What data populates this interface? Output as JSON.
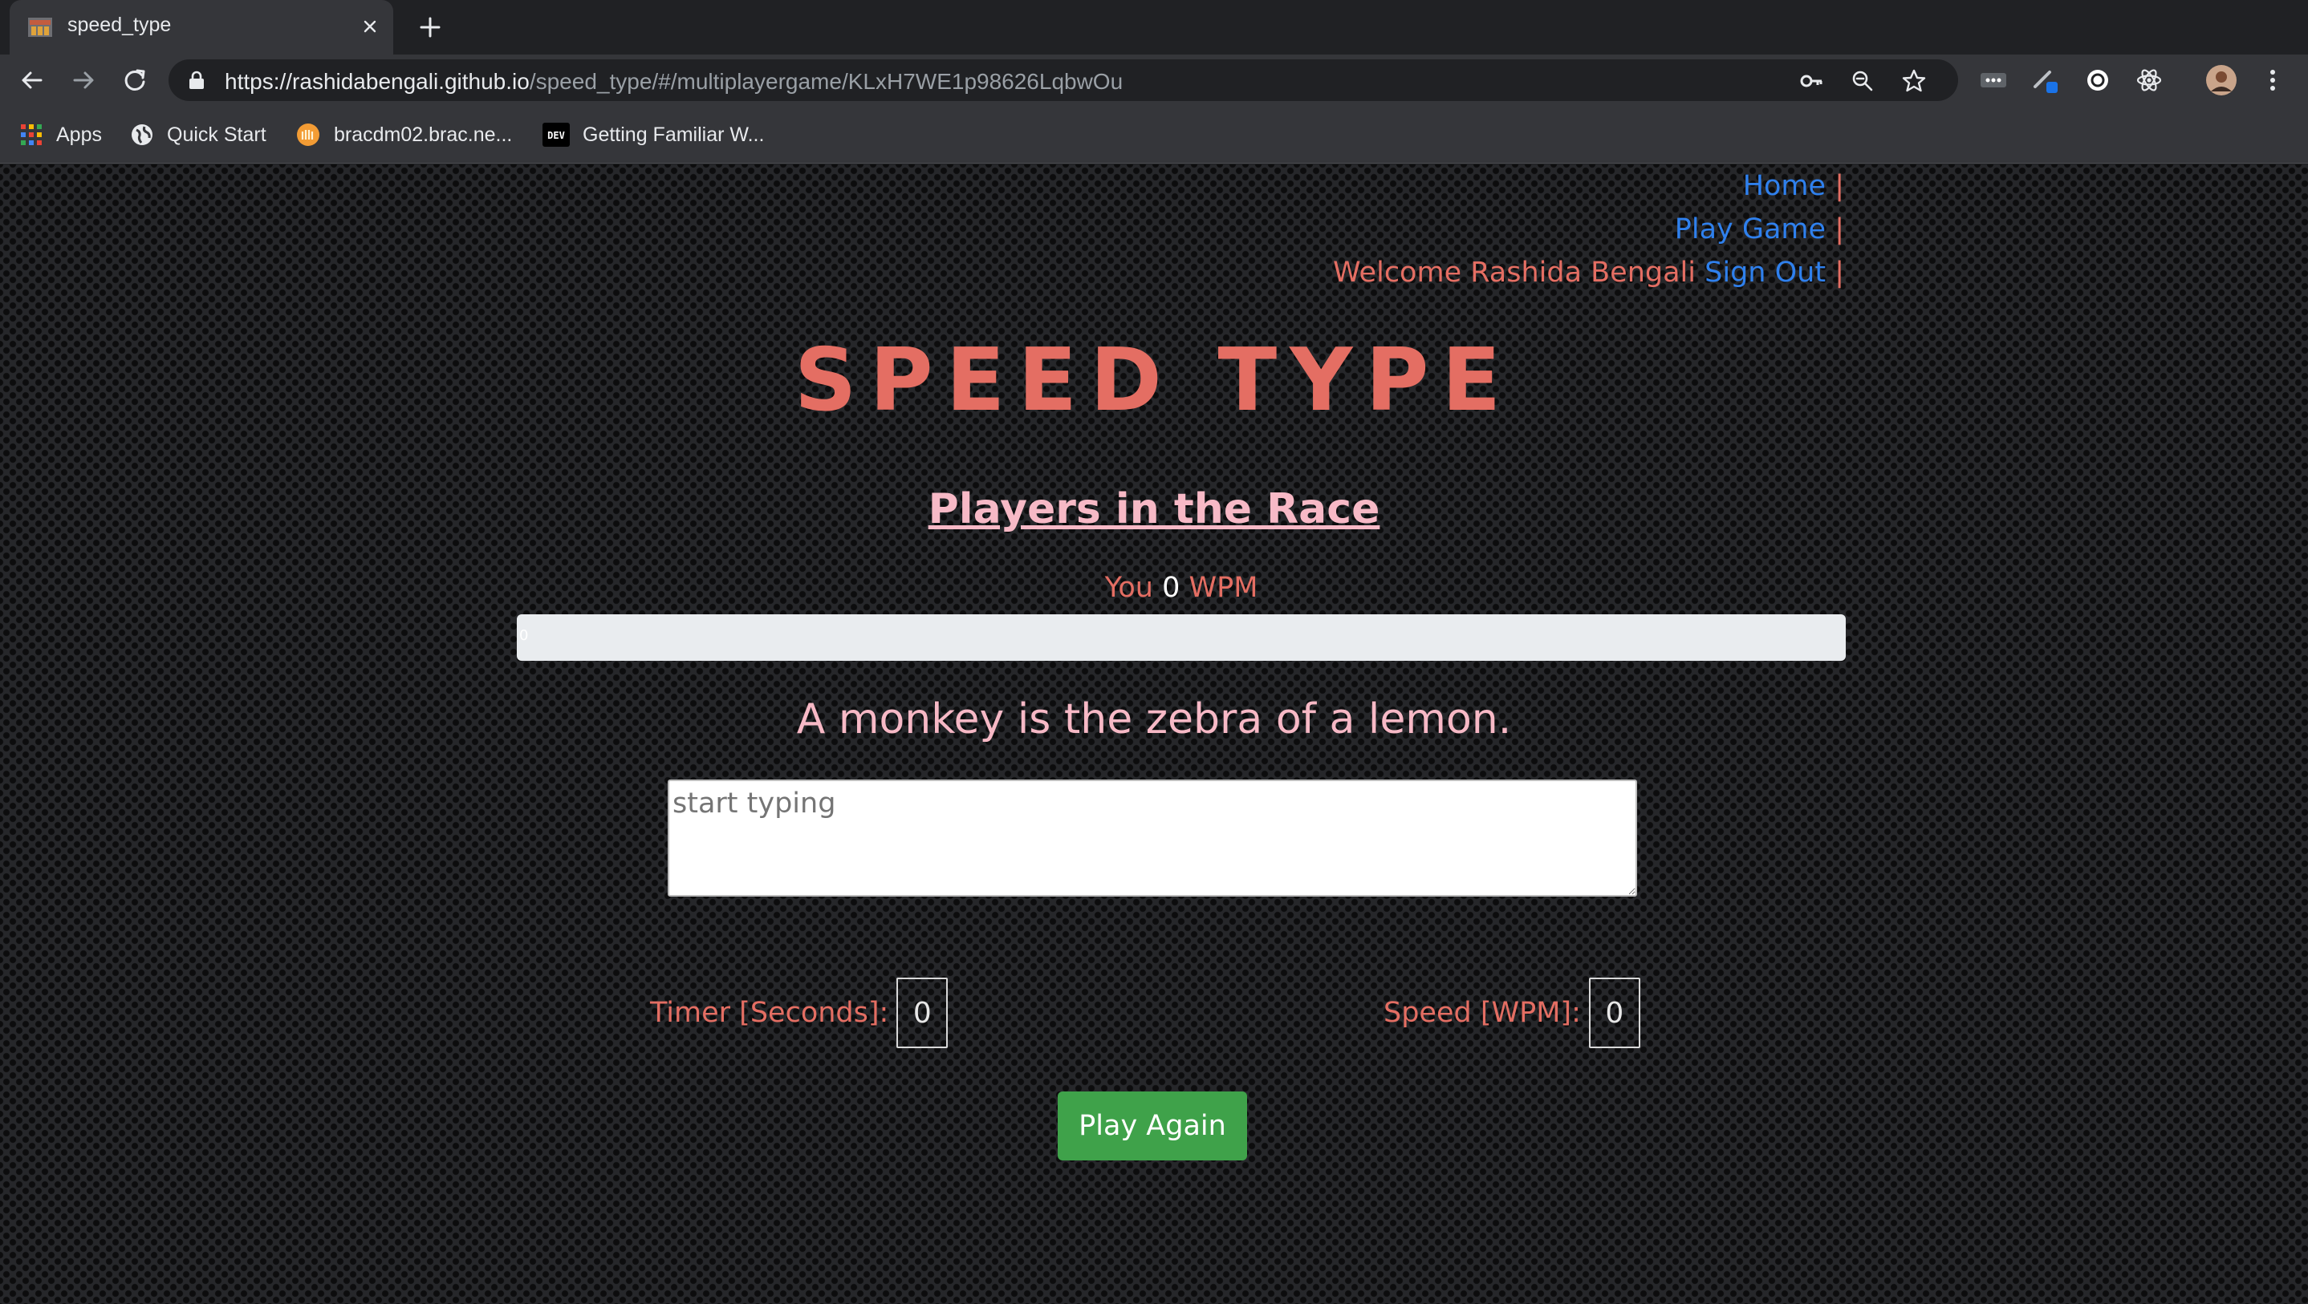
{
  "browser": {
    "tab_title": "speed_type",
    "url_host": "https://rashidabengali.github.io",
    "url_path": "/speed_type/#/multiplayergame/KLxH7WE1p98626LqbwOu",
    "bookmarks": [
      {
        "label": "Apps",
        "icon": "apps-grid-icon"
      },
      {
        "label": "Quick Start",
        "icon": "globe-icon"
      },
      {
        "label": "bracdm02.brac.ne...",
        "icon": "site-favicon-icon"
      },
      {
        "label": "Getting Familiar W...",
        "icon": "dev-logo-icon"
      }
    ],
    "dev_badge": "DEV"
  },
  "nav": {
    "home": "Home",
    "play_game": "Play Game",
    "welcome": "Welcome Rashida Bengali",
    "sign_out": "Sign Out",
    "separator": "|"
  },
  "game": {
    "logo": "SPEED TYPE",
    "players_title": "Players in the Race",
    "player": {
      "name": "You",
      "wpm": "0",
      "wpm_unit": "WPM",
      "progress_text": "0",
      "progress_fraction": 0
    },
    "sentence": "A monkey is the zebra of a lemon.",
    "input_placeholder": "start typing",
    "timer_label": "Timer [Seconds]:",
    "timer_value": "0",
    "speed_label": "Speed [WPM]:",
    "speed_value": "0",
    "play_again": "Play Again"
  },
  "colors": {
    "accent": "#e46e63",
    "pink": "#f7b9c6",
    "link": "#2f80ed",
    "button_green": "#3fa24a"
  }
}
